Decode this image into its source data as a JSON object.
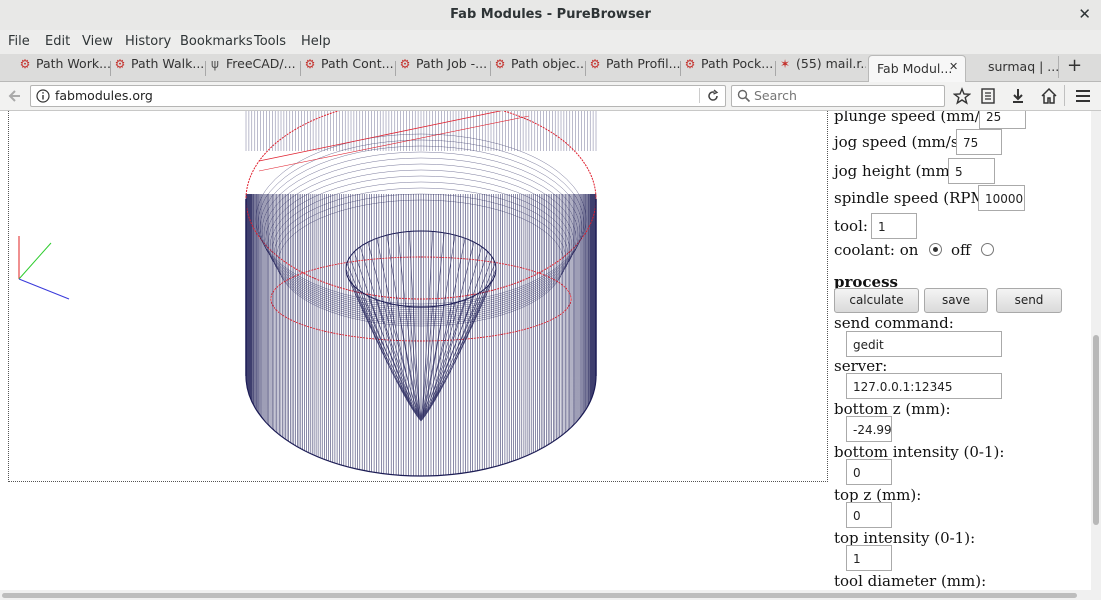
{
  "window": {
    "title": "Fab Modules - PureBrowser",
    "close_glyph": "✕"
  },
  "menu": [
    {
      "label": "File",
      "name": "menu-file"
    },
    {
      "label": "Edit",
      "name": "menu-edit"
    },
    {
      "label": "View",
      "name": "menu-view"
    },
    {
      "label": "History",
      "name": "menu-history"
    },
    {
      "label": "Bookmarks",
      "name": "menu-bookmarks"
    },
    {
      "label": "Tools",
      "name": "menu-tools"
    },
    {
      "label": "Help",
      "name": "menu-help"
    }
  ],
  "tabs": [
    {
      "label": "Path Work...",
      "icon": "freecad-icon"
    },
    {
      "label": "Path Walk...",
      "icon": "freecad-icon"
    },
    {
      "label": "FreeCAD/...",
      "icon": "fork-icon"
    },
    {
      "label": "Path Cont...",
      "icon": "freecad-icon"
    },
    {
      "label": "Path Job -...",
      "icon": "freecad-icon"
    },
    {
      "label": "Path objec...",
      "icon": "freecad-icon"
    },
    {
      "label": "Path Profil...",
      "icon": "freecad-icon"
    },
    {
      "label": "Path Pock...",
      "icon": "freecad-icon"
    },
    {
      "label": "(55) mail.r...",
      "icon": "mail-star-icon"
    },
    {
      "label": "Fab Modul...",
      "icon": "",
      "active": true
    },
    {
      "label": "surmaq | ...",
      "icon": ""
    }
  ],
  "tab_close_glyph": "✕",
  "new_tab_glyph": "+",
  "nav": {
    "url": "fabmodules.org",
    "search_placeholder": "Search"
  },
  "panel": {
    "plunge_speed_label": "plunge speed (mm/s):",
    "plunge_speed_value": "25",
    "jog_speed_label": "jog speed (mm/s):",
    "jog_speed_value": "75",
    "jog_height_label": "jog height (mm):",
    "jog_height_value": "5",
    "spindle_speed_label": "spindle speed (RPM):",
    "spindle_speed_value": "10000",
    "tool_label": "tool:",
    "tool_value": "1",
    "coolant_label": "coolant: on",
    "coolant_off_label": "off",
    "coolant_state": "on",
    "process_heading": "process",
    "calculate_label": "calculate",
    "save_label": "save",
    "send_label": "send",
    "send_command_label": "send command:",
    "send_command_value": "gedit",
    "server_label": "server:",
    "server_value": "127.0.0.1:12345",
    "bottom_z_label": "bottom z (mm):",
    "bottom_z_value": "-24.99",
    "bottom_intensity_label": "bottom intensity (0-1):",
    "bottom_intensity_value": "0",
    "top_z_label": "top z (mm):",
    "top_z_value": "0",
    "top_intensity_label": "top intensity (0-1):",
    "top_intensity_value": "1",
    "tool_diameter_label": "tool diameter (mm):"
  },
  "colors": {
    "toolpath": "#1c1c55",
    "rim": "#e0202e",
    "axis_x": "#3a3adb",
    "axis_y": "#2ecc2e",
    "axis_z": "#e02020"
  }
}
